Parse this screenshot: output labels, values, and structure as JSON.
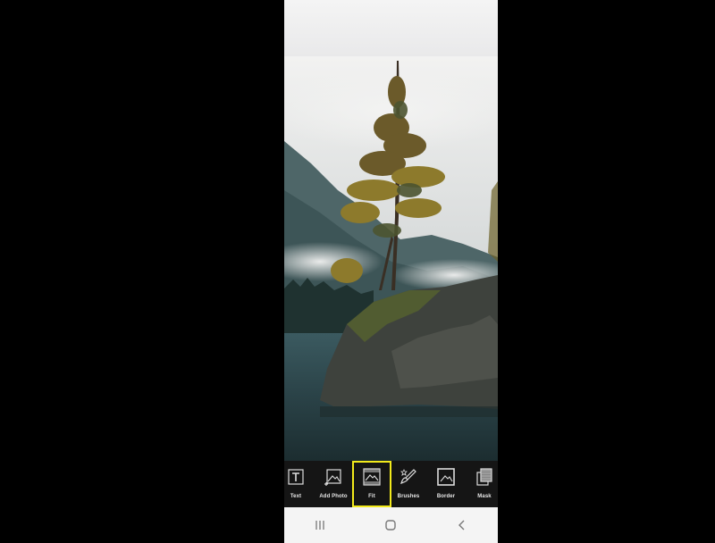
{
  "toolbar": {
    "items": [
      {
        "label": "Text",
        "icon": "text-icon"
      },
      {
        "label": "Add Photo",
        "icon": "add-photo-icon"
      },
      {
        "label": "Fit",
        "icon": "fit-icon",
        "selected": true
      },
      {
        "label": "Brushes",
        "icon": "brushes-icon"
      },
      {
        "label": "Border",
        "icon": "border-icon"
      },
      {
        "label": "Mask",
        "icon": "mask-icon"
      }
    ],
    "highlight_color": "#f2ea1b"
  },
  "nav": {
    "recents": "recents-icon",
    "home": "home-icon",
    "back": "back-icon"
  },
  "photo": {
    "subject": "lake-tree-photo"
  }
}
